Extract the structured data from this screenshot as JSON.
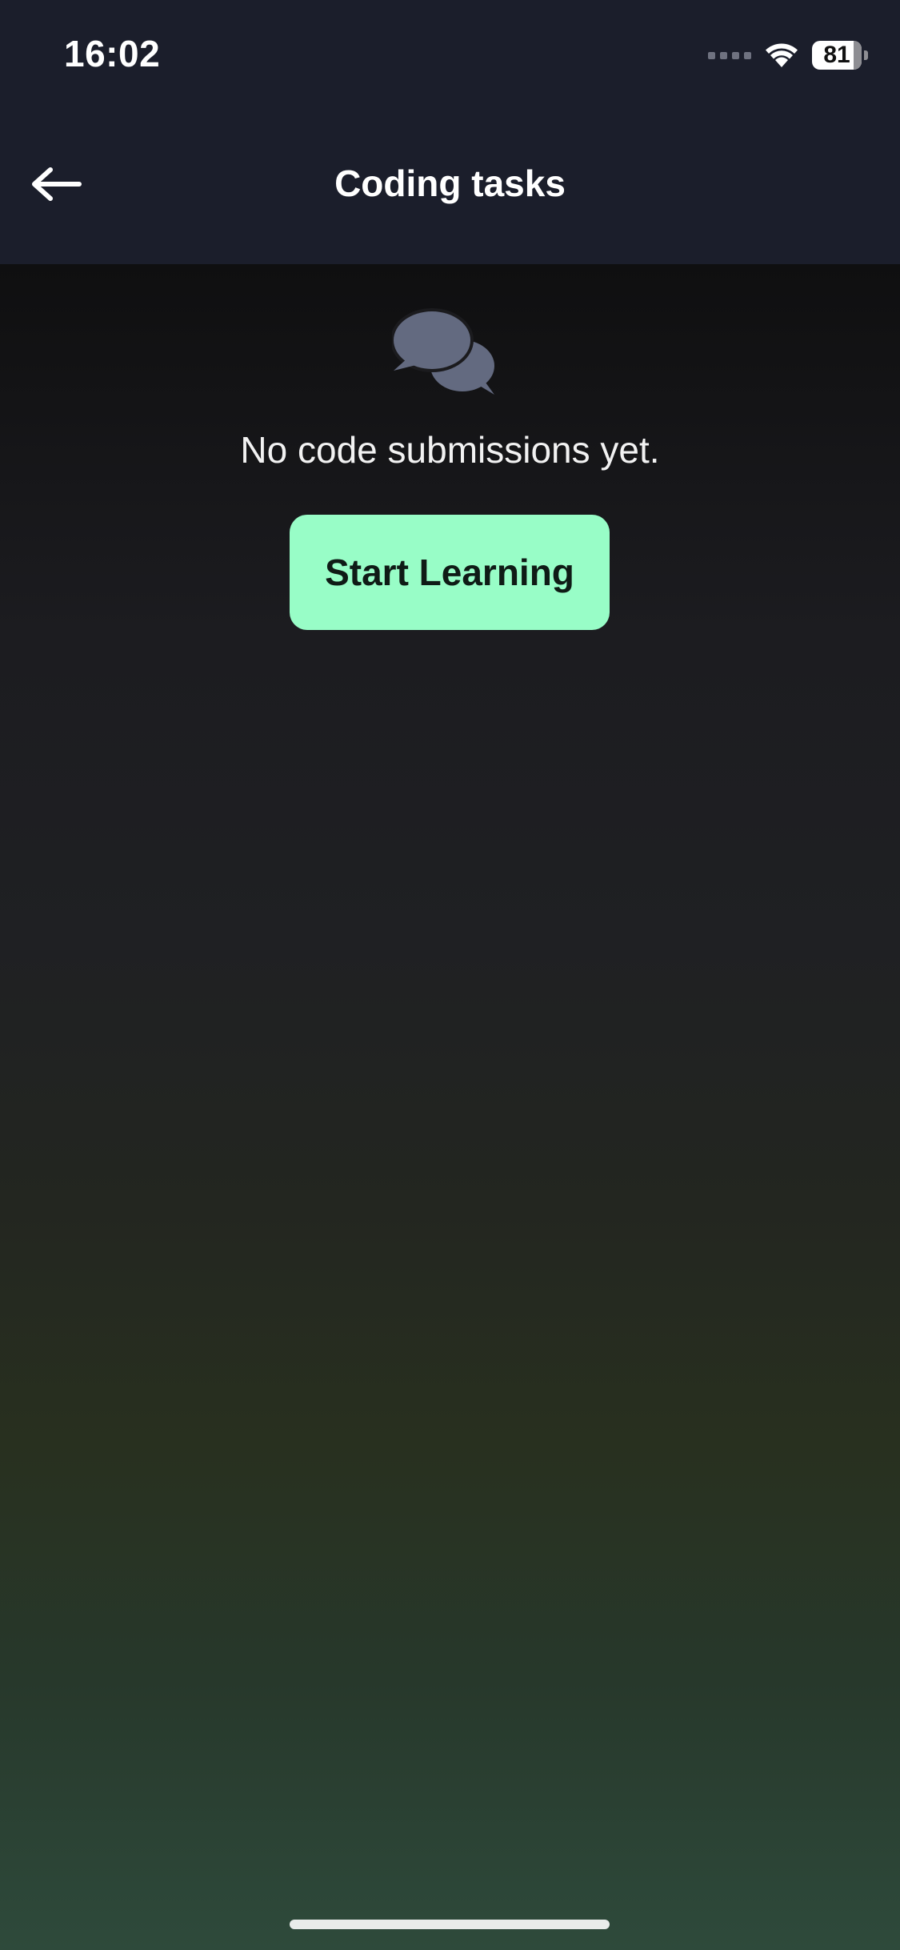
{
  "status_bar": {
    "time": "16:02",
    "battery_level": "81",
    "icons": [
      "signal-dots-icon",
      "wifi-icon",
      "battery-icon"
    ]
  },
  "nav": {
    "title": "Coding tasks",
    "back_icon": "arrow-left-icon"
  },
  "empty_state": {
    "icon": "chat-bubbles-icon",
    "message": "No code submissions yet.",
    "button_label": "Start Learning"
  },
  "colors": {
    "header_bg": "#1b1e2b",
    "accent_button": "#98fdc7",
    "icon_gray": "#636a80",
    "gradient_top": "#0f0f10",
    "gradient_bottom": "#2e4a3b"
  }
}
